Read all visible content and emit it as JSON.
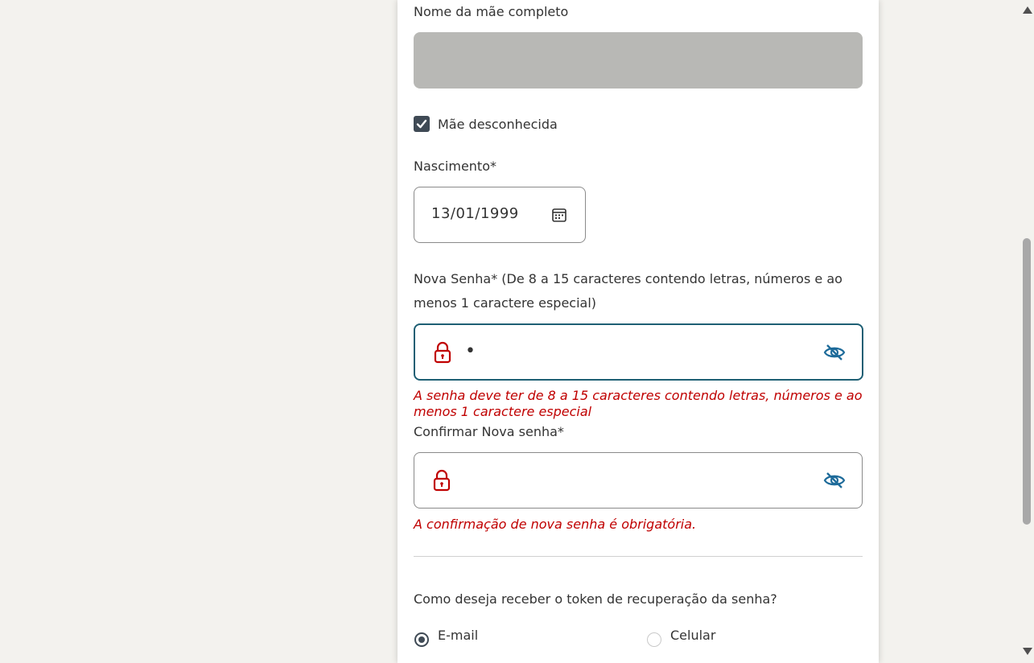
{
  "form": {
    "mother_name_label": "Nome da mãe completo",
    "mother_name_value": "",
    "mother_unknown_label": "Mãe desconhecida",
    "mother_unknown_checked": true,
    "birth_label": "Nascimento*",
    "birth_value": "13/01/1999",
    "new_password_label_line1": "Nova Senha* (De 8 a 15 caracteres contendo letras, números e ao",
    "new_password_label_line2": "menos 1 caractere especial)",
    "new_password_value_masked": "•",
    "new_password_error": "A senha deve ter de 8 a 15 caracteres contendo letras, números e ao menos 1 caractere especial",
    "confirm_password_label": "Confirmar Nova senha*",
    "confirm_password_value_masked": "",
    "confirm_password_error": "A confirmação de nova senha é obrigatória.",
    "token_question": "Como deseja receber o token de recuperação da senha?",
    "token_options": [
      {
        "label": "E-mail",
        "checked": true
      },
      {
        "label": "Celular",
        "checked": false
      }
    ]
  },
  "icons": {
    "calendar": "calendar-icon",
    "lock": "lock-icon",
    "eye_off": "eye-off-icon",
    "check": "check-icon"
  },
  "colors": {
    "error": "#c00000",
    "lock": "#c00000",
    "eye": "#1e6b9a",
    "focus_border": "#1e5f74",
    "checkbox": "#3f4a55",
    "disabled_input": "#b8b8b5"
  }
}
